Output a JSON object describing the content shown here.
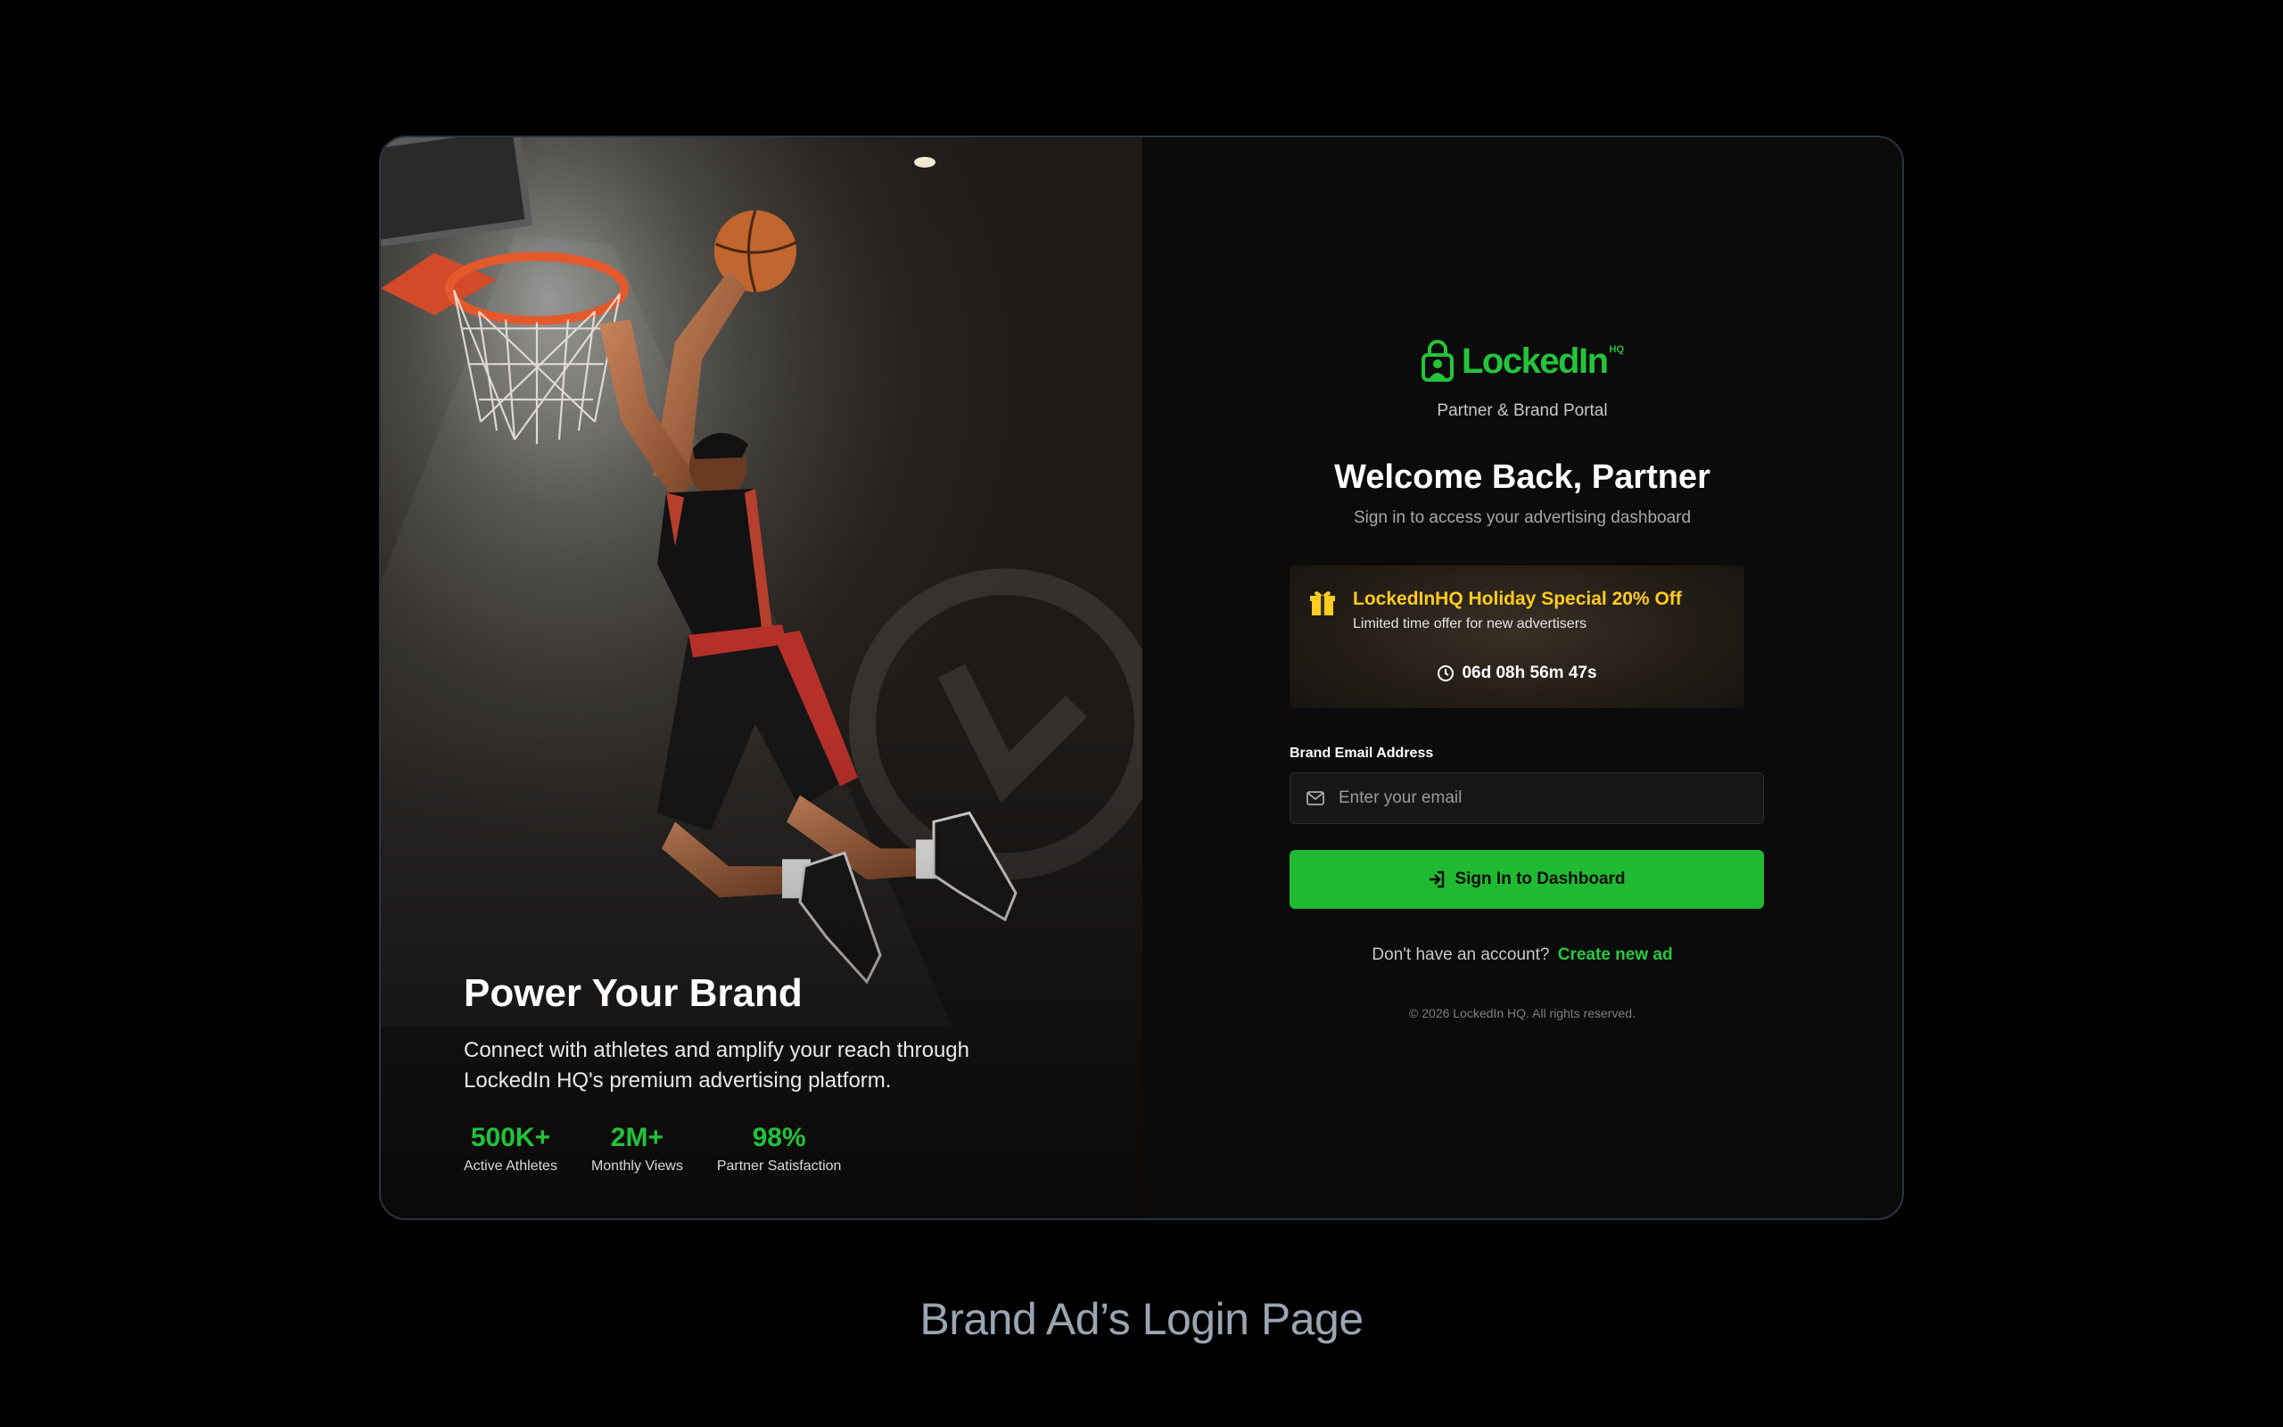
{
  "hero": {
    "title": "Power Your Brand",
    "subtitle_line1": "Connect with athletes and amplify your reach through",
    "subtitle_line2": "LockedIn HQ's premium advertising platform.",
    "stats": [
      {
        "value": "500K+",
        "label": "Active Athletes"
      },
      {
        "value": "2M+",
        "label": "Monthly Views"
      },
      {
        "value": "98%",
        "label": "Partner Satisfaction"
      }
    ]
  },
  "brand": {
    "logo_text": "LockedIn",
    "logo_sup": "HQ",
    "portal_label": "Partner & Brand Portal",
    "accent_color": "#22c23a"
  },
  "login": {
    "title": "Welcome Back, Partner",
    "subtitle": "Sign in to access your advertising dashboard",
    "email_label": "Brand Email Address",
    "email_placeholder": "Enter your email",
    "email_value": "",
    "submit_label": "Sign In to Dashboard",
    "signup_prompt": "Don't have an account?",
    "signup_link": "Create new ad",
    "copyright": "© 2026 LockedIn HQ. All rights reserved."
  },
  "promo": {
    "title": "LockedInHQ Holiday Special 20% Off",
    "subtitle": "Limited time offer for new advertisers",
    "countdown": "06d 08h 56m 47s",
    "highlight_color": "#ffcc1f"
  },
  "icons": [
    "lock-person-logo-icon",
    "gift-icon",
    "clock-icon",
    "mail-icon",
    "sign-in-icon"
  ],
  "caption": "Brand Ad’s Login Page"
}
